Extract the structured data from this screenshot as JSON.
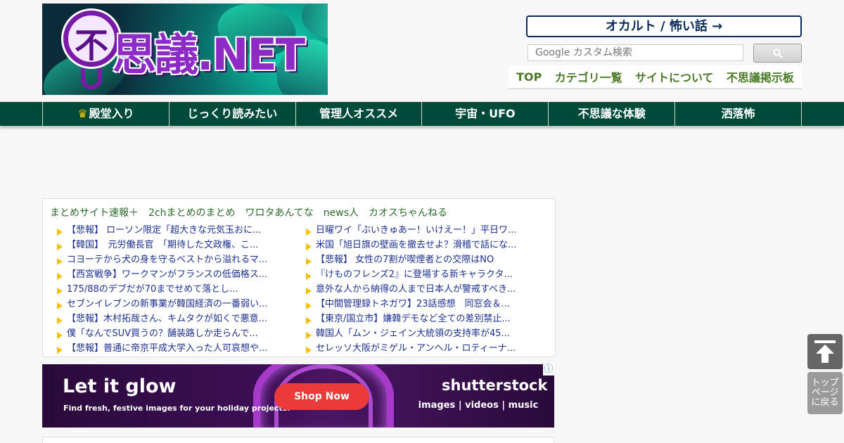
{
  "header": {
    "logo_emblem": "不",
    "logo_text": "思議.NET",
    "occult_link": "オカルト / 怖い話 →",
    "search_placeholder": "Google カスタム検索",
    "top_nav": [
      "TOP",
      "カテゴリ一覧",
      "サイトについて",
      "不思議掲示板"
    ]
  },
  "main_nav": [
    {
      "icon": "crown-icon",
      "label": "殿堂入り"
    },
    {
      "label": "じっくり読みたい"
    },
    {
      "label": "管理人オススメ"
    },
    {
      "label": "宇宙・UFO"
    },
    {
      "label": "不思議な体験"
    },
    {
      "label": "洒落怖"
    }
  ],
  "antenna": {
    "sites": [
      "まとめサイト速報＋",
      "2chまとめのまとめ",
      "ワロタあんてな",
      "news人",
      "カオスちゃんねる"
    ],
    "left": [
      "【悲報】 ローソン限定「超大きな元気玉おに...",
      "【韓国】　元労働長官　「期待した文政権、こ...",
      "コヨーテから犬の身を守るベストから溢れるマ...",
      "【西宮戦争】ワークマンがフランスの低価格ス...",
      "175/88のデブだが70までせめて落とし...",
      "セブンイレブンの新事業が韓国経済の一番弱い...",
      "【悲報】木村拓哉さん、キムタクが如くで悪意...",
      "僕「なんでSUV買うの？舗装路しか走らんで...",
      "【悲報】普通に帝京平成大学入った人可哀想や..."
    ],
    "right": [
      "日曜ワイ「ぶいきゅあー！いけえー！」平日ワ...",
      "米国「旭日旗の壁画を撤去せよ？滑稽で話にな...",
      "【悲報】 女性の7割が喫煙者との交際はNO",
      "『けものフレンズ2』に登場する新キャラクタ...",
      "意外な人から納得の人まで日本人が警戒すべき...",
      "【中間管理録トネガワ】23話感想　同窓会＆...",
      "【東京/国立市】嫌韓デモなど全ての差別禁止...",
      "韓国人「ムン・ジェイン大統領の支持率が45...",
      "セレッソ大阪がミゲル・アンヘル・ロティーナ..."
    ]
  },
  "ad": {
    "headline": "Let it glow",
    "sub": "Find fresh, festive images for your holiday projects.",
    "cta": "Shop Now",
    "brand": "shutterstock",
    "tags": "images   |   videos   |   music",
    "info": "ⓘ"
  },
  "to_top": {
    "icon": "arrow-up-icon",
    "label": "トップ\nページ\nに戻る"
  }
}
